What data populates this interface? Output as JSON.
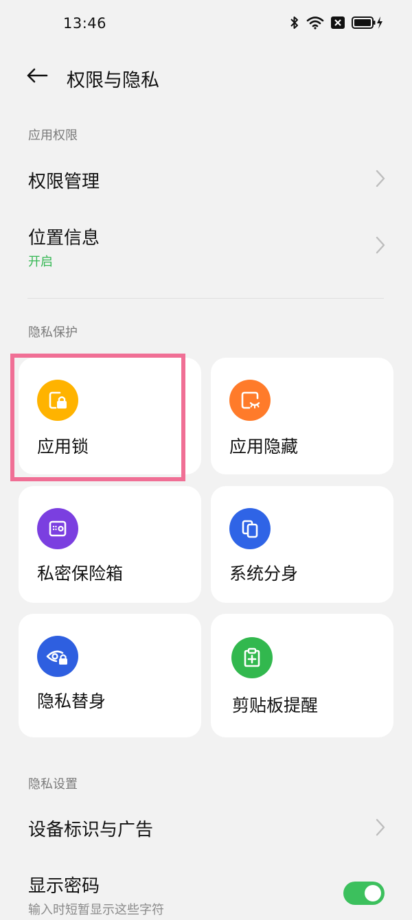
{
  "status_bar": {
    "time": "13:46",
    "icons": [
      "bluetooth-icon",
      "wifi-icon",
      "sim-off-icon",
      "battery-charging-icon"
    ]
  },
  "header": {
    "title": "权限与隐私",
    "back_icon": "arrow-left-icon"
  },
  "sections": {
    "app_permissions": {
      "label": "应用权限",
      "items": [
        {
          "title": "权限管理",
          "subtitle": ""
        },
        {
          "title": "位置信息",
          "subtitle": "开启"
        }
      ]
    },
    "privacy_protection": {
      "label": "隐私保护",
      "cards": [
        {
          "label": "应用锁",
          "icon": "app-lock-icon",
          "color": "#ffb300"
        },
        {
          "label": "应用隐藏",
          "icon": "app-hide-icon",
          "color": "#ff7b2a"
        },
        {
          "label": "私密保险箱",
          "icon": "safe-box-icon",
          "color": "#7b3fe0"
        },
        {
          "label": "系统分身",
          "icon": "system-clone-icon",
          "color": "#2f64e6"
        },
        {
          "label": "隐私替身",
          "icon": "privacy-eye-lock-icon",
          "color": "#2e5fe0"
        },
        {
          "label": "剪贴板提醒",
          "icon": "clipboard-icon",
          "color": "#32b84e"
        }
      ]
    },
    "privacy_settings": {
      "label": "隐私设置",
      "items": [
        {
          "title": "设备标识与广告",
          "subtitle": ""
        },
        {
          "title": "显示密码",
          "subtitle": "输入时短暂显示这些字符",
          "toggle_on": true
        }
      ]
    }
  },
  "colors": {
    "background": "#f2f2f2",
    "accent_green": "#34b753",
    "toggle_on": "#3cc05d",
    "highlight": "#f06f95"
  }
}
